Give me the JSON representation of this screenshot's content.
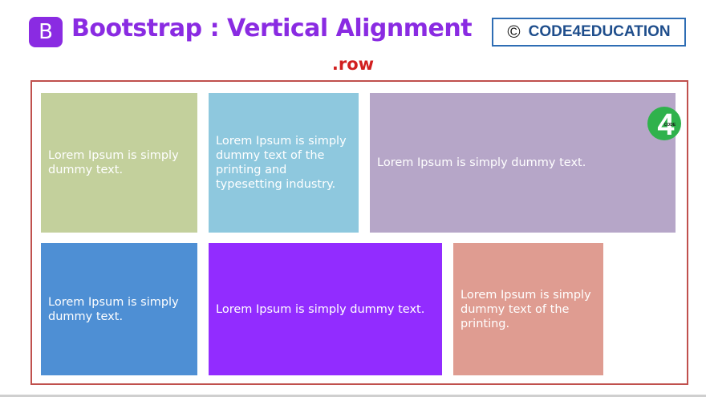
{
  "header": {
    "logo_letter": "B",
    "title": "Bootstrap : Vertical Alignment",
    "brand_symbol": "©",
    "brand_name": "CODE4EDUCATION",
    "subtitle": ".row"
  },
  "colors": {
    "accent": "#8a2be2",
    "row_border": "#c0504d",
    "subtitle": "#d11f1f"
  },
  "cells": [
    {
      "text": "Lorem Ipsum is simply dummy text.",
      "color": "#c3d09c"
    },
    {
      "text": "Lorem Ipsum is simply dummy text of the printing and typesetting industry.",
      "color": "#8ec8de"
    },
    {
      "text": "Lorem Ipsum is simply dummy text.",
      "color": "#b6a6c8"
    },
    {
      "text": "Lorem Ipsum is simply dummy text.",
      "color": "#4e8fd4"
    },
    {
      "text": "Lorem Ipsum is simply dummy text.",
      "color": "#922cff"
    },
    {
      "text": "Lorem Ipsum is simply dummy text of the printing.",
      "color": "#df9c91"
    }
  ],
  "watermark": {
    "digit": "4",
    "label": "CODE"
  }
}
